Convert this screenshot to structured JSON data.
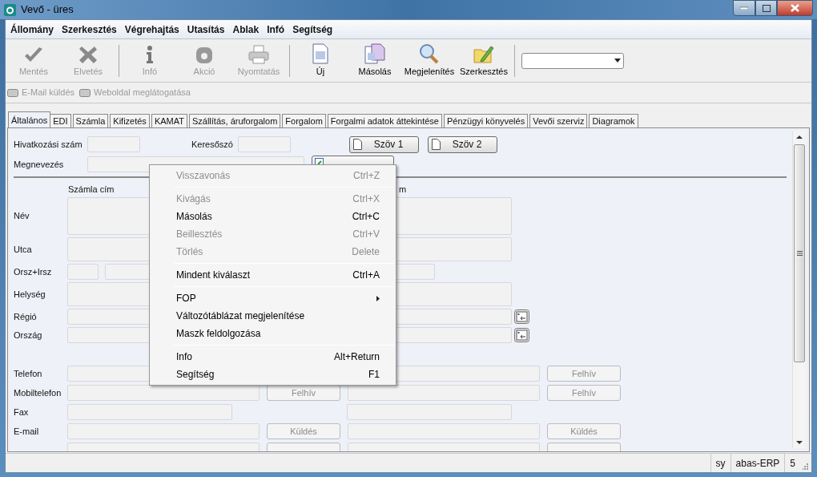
{
  "window": {
    "title": "Vevő - üres"
  },
  "menu_bar": [
    "Állomány",
    "Szerkesztés",
    "Végrehajtás",
    "Utasítás",
    "Ablak",
    "Infó",
    "Segítség"
  ],
  "toolbar": [
    {
      "kind": "button",
      "label": "Mentés",
      "disabled": true
    },
    {
      "kind": "button",
      "label": "Elvetés",
      "disabled": true
    },
    {
      "kind": "separator"
    },
    {
      "kind": "button",
      "label": "Infó",
      "disabled": true
    },
    {
      "kind": "button",
      "label": "Akció",
      "disabled": true
    },
    {
      "kind": "button",
      "label": "Nyomtatás",
      "disabled": true
    },
    {
      "kind": "separator"
    },
    {
      "kind": "button",
      "label": "Új",
      "disabled": false
    },
    {
      "kind": "button",
      "label": "Másolás",
      "disabled": false
    },
    {
      "kind": "button",
      "label": "Megjelenítés",
      "disabled": false
    },
    {
      "kind": "button",
      "label": "Szerkesztés",
      "disabled": false
    },
    {
      "kind": "separator"
    },
    {
      "kind": "combo"
    }
  ],
  "sub_toolbar": [
    {
      "label": "E-Mail küldés",
      "disabled": true
    },
    {
      "label": "Weboldal meglátogatása",
      "disabled": true
    }
  ],
  "tabs": [
    {
      "label": "Általános",
      "selected": true
    },
    {
      "label": "EDI",
      "selected": false
    },
    {
      "label": "Számla",
      "selected": false
    },
    {
      "label": "Kifizetés",
      "selected": false
    },
    {
      "label": "KAMAT",
      "selected": false
    },
    {
      "label": "Szállítás, áruforgalom",
      "selected": false
    },
    {
      "label": "Forgalom",
      "selected": false
    },
    {
      "label": "Forgalmi adatok áttekintése",
      "selected": false
    },
    {
      "label": "Pénzügyi könyvelés",
      "selected": false
    },
    {
      "label": "Vevői szerviz",
      "selected": false
    },
    {
      "label": "Diagramok",
      "selected": false
    }
  ],
  "form": {
    "reference_label": "Hivatkozási szám",
    "keyword_label": "Keresőszó",
    "text_buttons": [
      "Szöv 1",
      "Szöv 2"
    ],
    "name_label": "Megnevezés",
    "column_headings": [
      "Számla cím",
      "m"
    ],
    "address_rows": [
      {
        "label": "Név",
        "kind": "tall"
      },
      {
        "label": "Utca",
        "kind": "medium"
      },
      {
        "label": "Orsz+Irsz",
        "kind": "split"
      },
      {
        "label": "Helység",
        "kind": "medium"
      },
      {
        "label": "Régió",
        "kind": "lookup"
      },
      {
        "label": "Ország",
        "kind": "lookup"
      }
    ],
    "contact_rows": [
      {
        "label": "Telefon",
        "kind": "button",
        "right_button": "Felhív"
      },
      {
        "label": "Mobiltelefon",
        "kind": "button",
        "left_button": "Felhív",
        "right_button": "Felhív"
      },
      {
        "label": "Fax",
        "kind": "short"
      },
      {
        "label": "E-mail",
        "kind": "button",
        "left_button": "Küldés",
        "right_button": "Küldés"
      },
      {
        "kind": "cut"
      }
    ]
  },
  "context_menu": [
    [
      {
        "label": "Visszavonás",
        "shortcut": "Ctrl+Z",
        "disabled": true,
        "submenu": false
      }
    ],
    [
      {
        "label": "Kivágás",
        "shortcut": "Ctrl+X",
        "disabled": true,
        "submenu": false
      },
      {
        "label": "Másolás",
        "shortcut": "Ctrl+C",
        "disabled": false,
        "submenu": false
      },
      {
        "label": "Beillesztés",
        "shortcut": "Ctrl+V",
        "disabled": true,
        "submenu": false
      },
      {
        "label": "Törlés",
        "shortcut": "Delete",
        "disabled": true,
        "submenu": false
      }
    ],
    [
      {
        "label": "Mindent kiválaszt",
        "shortcut": "Ctrl+A",
        "disabled": false,
        "submenu": false
      }
    ],
    [
      {
        "label": "FOP",
        "disabled": false,
        "submenu": true
      },
      {
        "label": "Változótáblázat megjelenítése",
        "disabled": false,
        "submenu": false
      },
      {
        "label": "Maszk feldolgozása",
        "disabled": false,
        "submenu": false
      }
    ],
    [
      {
        "label": "Info",
        "shortcut": "Alt+Return",
        "disabled": false,
        "submenu": false
      },
      {
        "label": "Segítség",
        "shortcut": "F1",
        "disabled": false,
        "submenu": false
      }
    ]
  ],
  "status_bar": [
    "sy",
    "abas-ERP",
    "5"
  ]
}
